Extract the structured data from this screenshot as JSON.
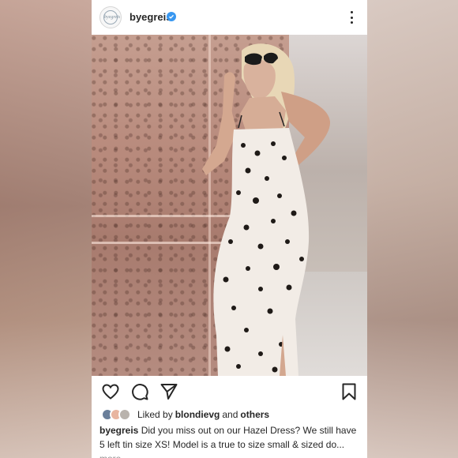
{
  "post": {
    "username": "byegreis",
    "avatar_text": "byegreis",
    "verified": true,
    "likes": {
      "prefix": "Liked by",
      "liker": "blondievg",
      "and": "and",
      "others": "others"
    },
    "caption": {
      "username": "byegreis",
      "text": "Did you miss out on our Hazel Dress? We still have 5 left tin size XS! Model is a true to size small & sized do...",
      "more": "more"
    },
    "icons": [
      "like-icon",
      "comment-icon",
      "share-icon",
      "save-icon",
      "more-options-icon"
    ],
    "colors": {
      "verified": "#3897f0",
      "text": "#262626",
      "muted": "#8e8e8e"
    }
  }
}
